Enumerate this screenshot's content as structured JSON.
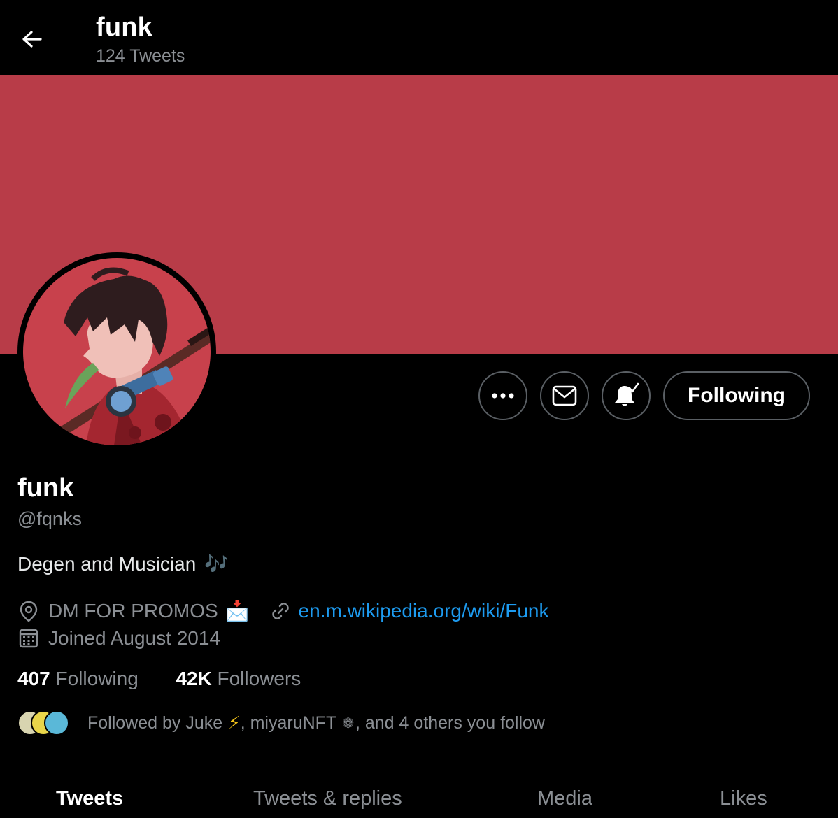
{
  "header": {
    "title": "funk",
    "tweet_count": "124 Tweets"
  },
  "colors": {
    "banner": "#b83c48",
    "link": "#1d9bf0",
    "muted": "#8b8f94"
  },
  "actions": {
    "more_icon": "more-icon",
    "message_icon": "mail-icon",
    "notify_icon": "bell-check-icon",
    "follow_label": "Following"
  },
  "profile": {
    "name": "funk",
    "handle": "@fqnks",
    "bio": "Degen and Musician",
    "bio_emoji": "🎶",
    "location": "DM FOR PROMOS",
    "location_emoji": "📩",
    "website": "en.m.wikipedia.org/wiki/Funk",
    "joined": "Joined August 2014"
  },
  "stats": {
    "following_count": "407",
    "following_label": "Following",
    "followers_count": "42K",
    "followers_label": "Followers"
  },
  "followed_by": {
    "prefix": "Followed by Juke",
    "emoji1": "⚡",
    "middle": ", miyaruNFT",
    "emoji2": "❁",
    "suffix": ", and 4 others you follow"
  },
  "tabs": [
    "Tweets",
    "Tweets & replies",
    "Media",
    "Likes"
  ]
}
